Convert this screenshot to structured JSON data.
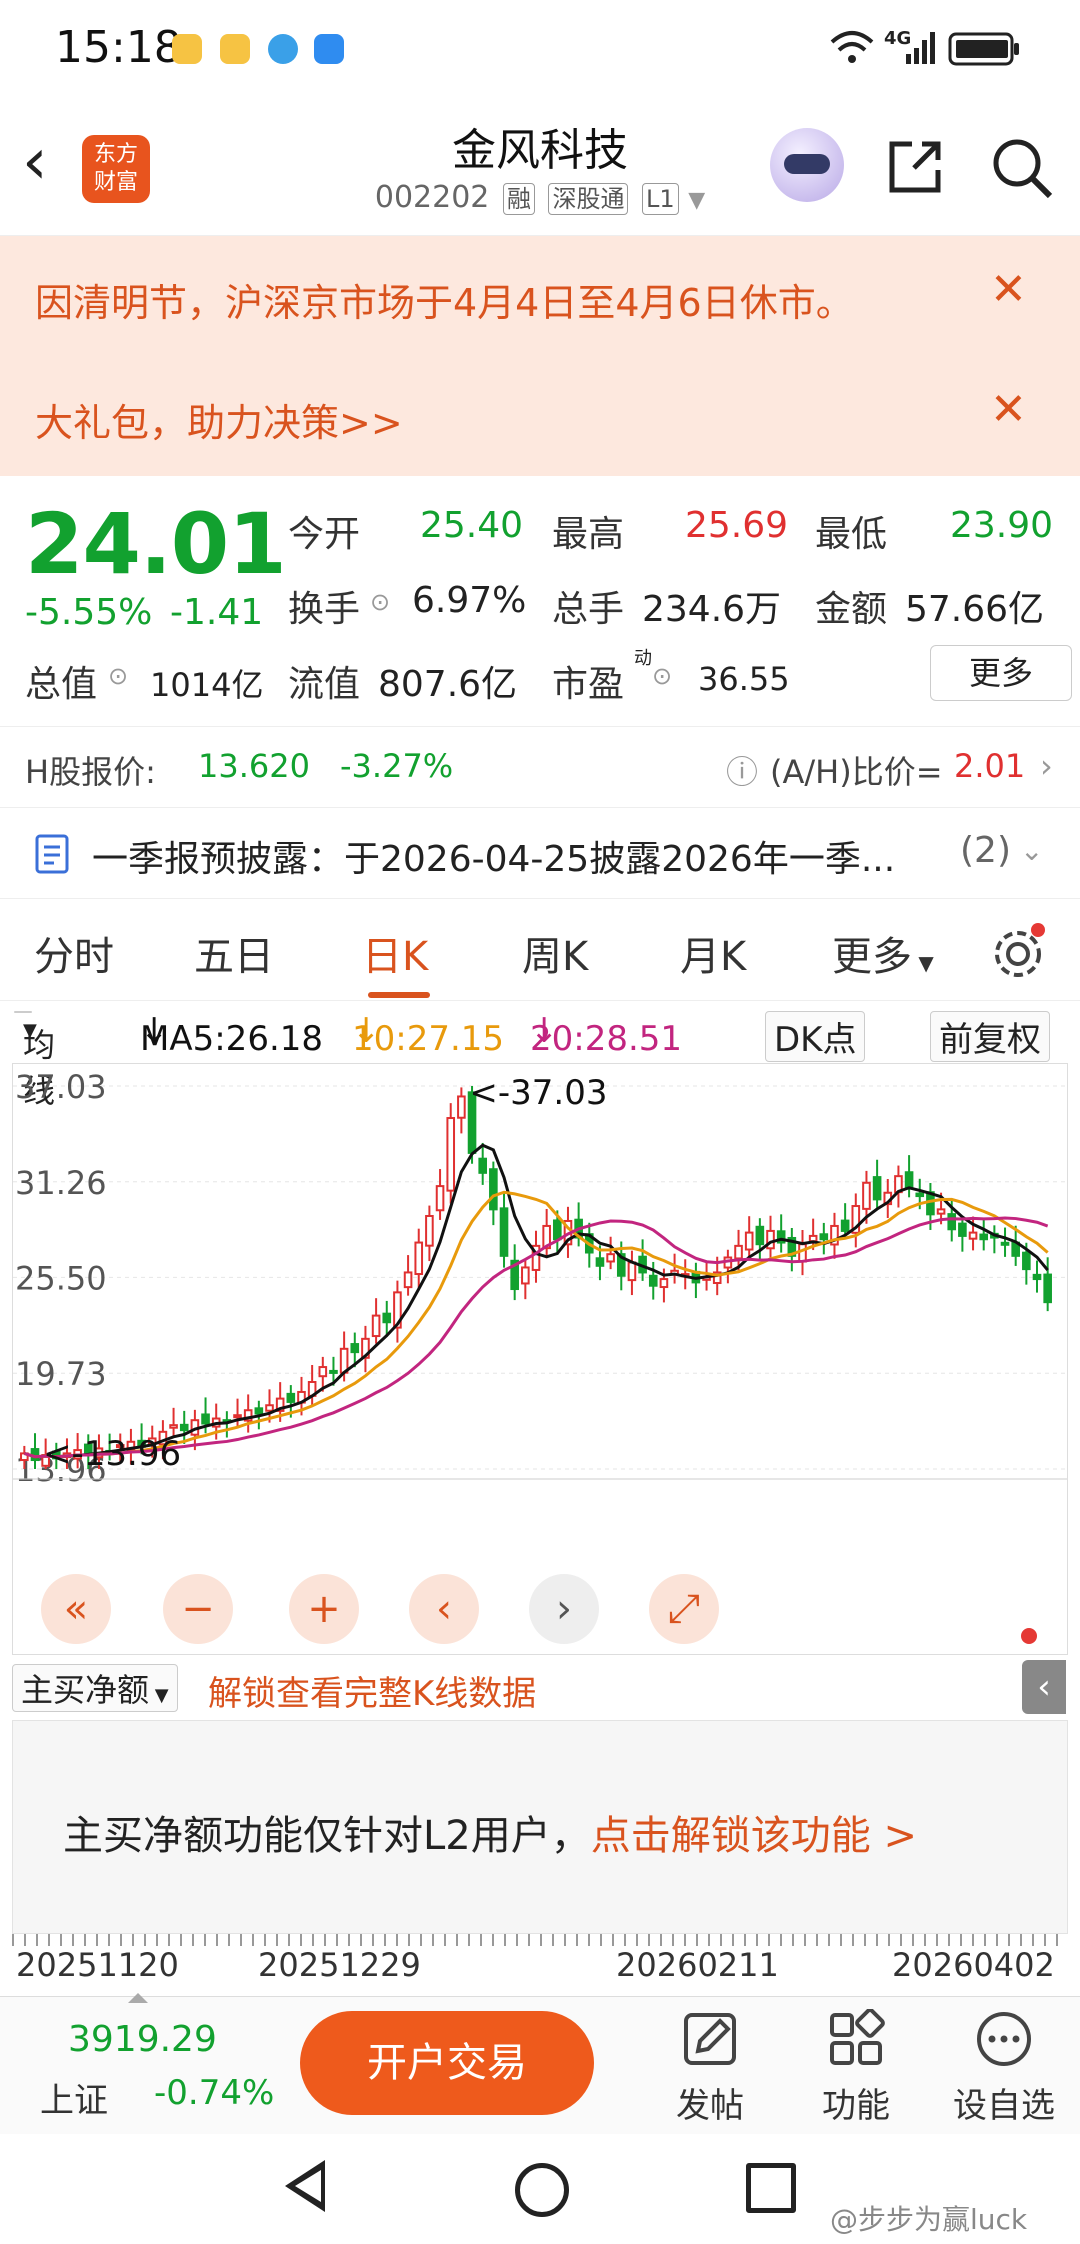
{
  "status": {
    "time": "15:18",
    "network": "4G"
  },
  "header": {
    "name": "金风科技",
    "code": "002202",
    "tags": [
      "融",
      "深股通",
      "L1"
    ]
  },
  "notices": [
    {
      "text": "因清明节，沪深京市场于4月4日至4月6日休市。",
      "close": "✕"
    },
    {
      "text": "大礼包，助力决策>>",
      "close": "✕"
    }
  ],
  "quote": {
    "price": "24.01",
    "change_pct": "-5.55%",
    "change": "-1.41",
    "open_label": "今开",
    "open": "25.40",
    "high_label": "最高",
    "high": "25.69",
    "low_label": "最低",
    "low": "23.90",
    "turnover_label": "换手",
    "turnover": "6.97%",
    "volume_label": "总手",
    "volume": "234.6万",
    "amount_label": "金额",
    "amount": "57.66亿",
    "mcap_label": "总值",
    "mcap": "1014亿",
    "float_label": "流值",
    "float": "807.6亿",
    "pe_label": "市盈",
    "pe_sup": "动",
    "pe": "36.55",
    "more": "更多"
  },
  "h_share": {
    "label": "H股报价:",
    "price": "13.620",
    "pct": "-3.27%",
    "ah_label": "(A/H)比价=",
    "ah_value": "2.01"
  },
  "disclosure": {
    "text": "一季报预披露：于2026-04-25披露2026年一季...",
    "count": "(2)"
  },
  "tabs": [
    "分时",
    "五日",
    "日K",
    "周K",
    "月K",
    "更多"
  ],
  "active_tab": "日K",
  "ma": {
    "selector": "均线",
    "ma5": "MA5:26.18",
    "ma10": "10:27.15",
    "ma20": "20:28.51",
    "dk": "DK点",
    "adjust": "前复权"
  },
  "colors": {
    "accent": "#d9531e",
    "up": "#e03030",
    "down": "#12a12f",
    "ma5": "#111111",
    "ma10": "#e89a0c",
    "ma20": "#c2257f"
  },
  "chart_data": {
    "type": "candlestick",
    "y_ticks": [
      "37.03",
      "31.26",
      "25.50",
      "19.73",
      "13.96"
    ],
    "ylim": [
      13.96,
      37.03
    ],
    "x_ticks": [
      "20251120",
      "20251229",
      "20260211",
      "20260402"
    ],
    "annotations": [
      "<-37.03",
      "<-13.96"
    ],
    "closes": [
      14.9,
      14.5,
      14.8,
      14.6,
      14.9,
      15.1,
      14.8,
      15.2,
      15.0,
      15.4,
      15.6,
      15.3,
      15.8,
      16.2,
      16.6,
      16.3,
      16.9,
      16.7,
      17.0,
      16.8,
      17.2,
      17.5,
      17.3,
      17.8,
      18.2,
      18.0,
      18.6,
      19.2,
      20.1,
      19.8,
      21.2,
      21.0,
      21.8,
      23.2,
      22.8,
      24.6,
      25.8,
      27.6,
      29.2,
      31.0,
      35.1,
      36.4,
      33.0,
      31.8,
      29.6,
      26.8,
      24.8,
      26.1,
      27.4,
      28.6,
      27.8,
      28.9,
      27.9,
      27.0,
      26.2,
      26.9,
      25.6,
      26.4,
      25.8,
      25.0,
      25.4,
      25.9,
      25.7,
      25.2,
      25.5,
      25.8,
      26.7,
      27.4,
      28.2,
      27.5,
      28.3,
      27.6,
      26.8,
      27.5,
      28.0,
      27.8,
      28.6,
      28.3,
      29.8,
      31.2,
      30.2,
      30.6,
      31.6,
      30.9,
      30.4,
      29.3,
      29.6,
      28.4,
      28.0,
      28.2,
      27.8,
      27.9,
      27.5,
      26.8,
      26.0,
      25.4,
      24.01
    ]
  },
  "chart_buttons": [
    "«",
    "−",
    "+",
    "‹",
    "›",
    "⤢"
  ],
  "buy": {
    "selector": "主买净额",
    "unlock_link": "解锁查看完整K线数据",
    "panel_text": "主买净额功能仅针对L2用户，",
    "panel_link": "点击解锁该功能 >"
  },
  "bottom": {
    "index_value": "3919.29",
    "index_name": "上证",
    "index_pct": "-0.74%",
    "open_account": "开户交易",
    "items": [
      {
        "icon": "edit-icon",
        "label": "发帖"
      },
      {
        "icon": "grid-icon",
        "label": "功能"
      },
      {
        "icon": "more-icon",
        "label": "设自选"
      }
    ]
  },
  "watermark": "@步步为赢luck"
}
